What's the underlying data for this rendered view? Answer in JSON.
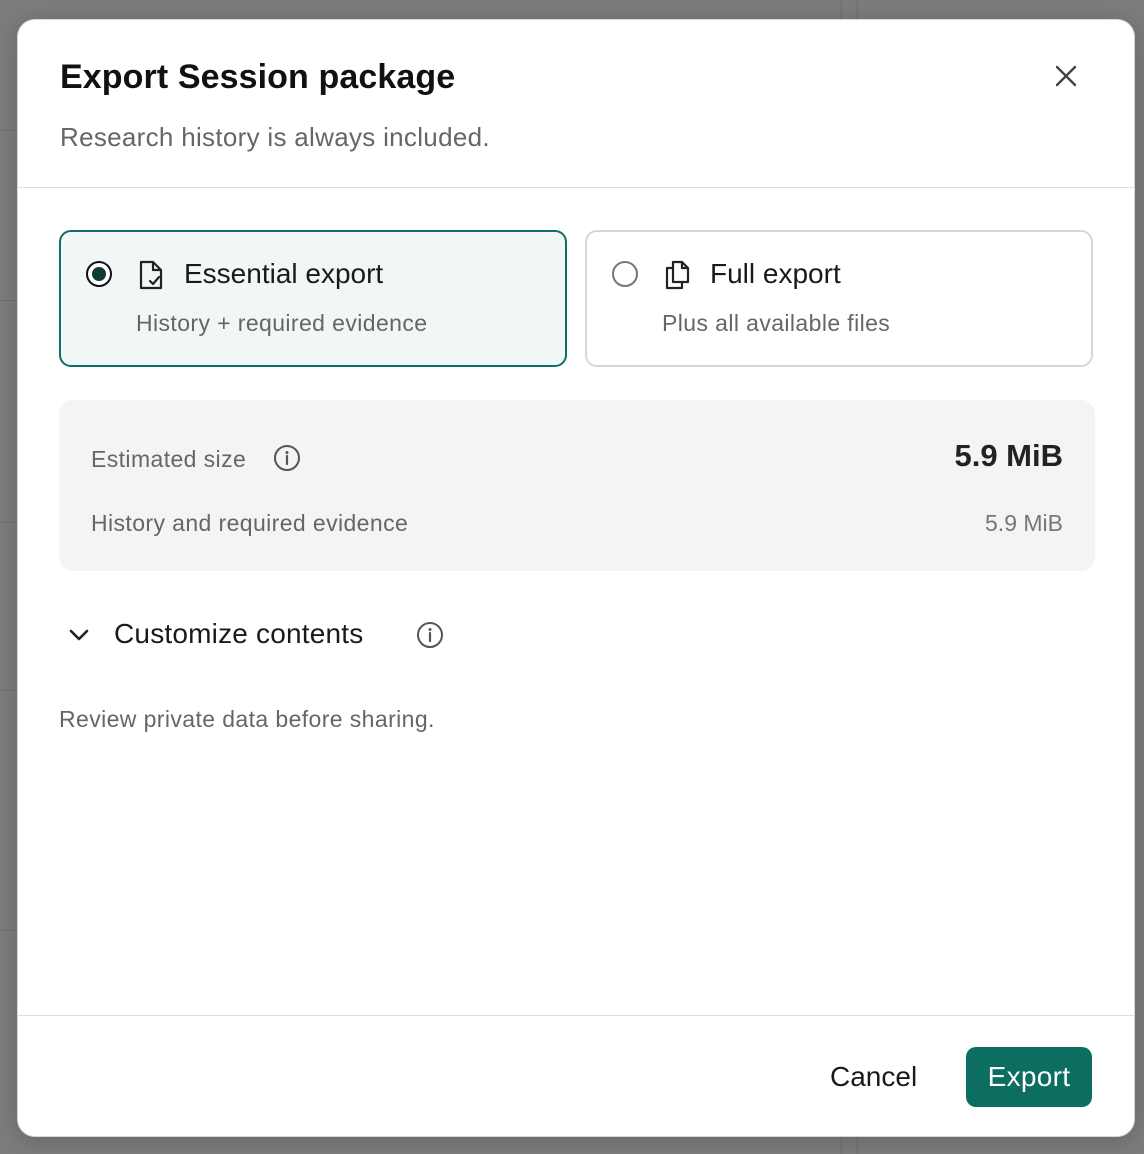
{
  "dialog": {
    "title": "Export Session package",
    "subtitle": "Research history is always included."
  },
  "options": [
    {
      "label": "Essential export",
      "description": "History + required evidence",
      "selected": true,
      "icon": "file-check-icon"
    },
    {
      "label": "Full export",
      "description": "Plus all available files",
      "selected": false,
      "icon": "files-copy-icon"
    }
  ],
  "estimate": {
    "label": "Estimated size",
    "total": "5.9 MiB",
    "rows": [
      {
        "label": "History and required evidence",
        "value": "5.9 MiB"
      }
    ]
  },
  "customize": {
    "label": "Customize contents",
    "expanded": true
  },
  "note": "Review private data before sharing.",
  "footer": {
    "cancel": "Cancel",
    "export": "Export"
  },
  "colors": {
    "accent": "#0b6e60",
    "selected_bg": "#f1f7f6",
    "panel_bg": "#f4f4f2"
  }
}
